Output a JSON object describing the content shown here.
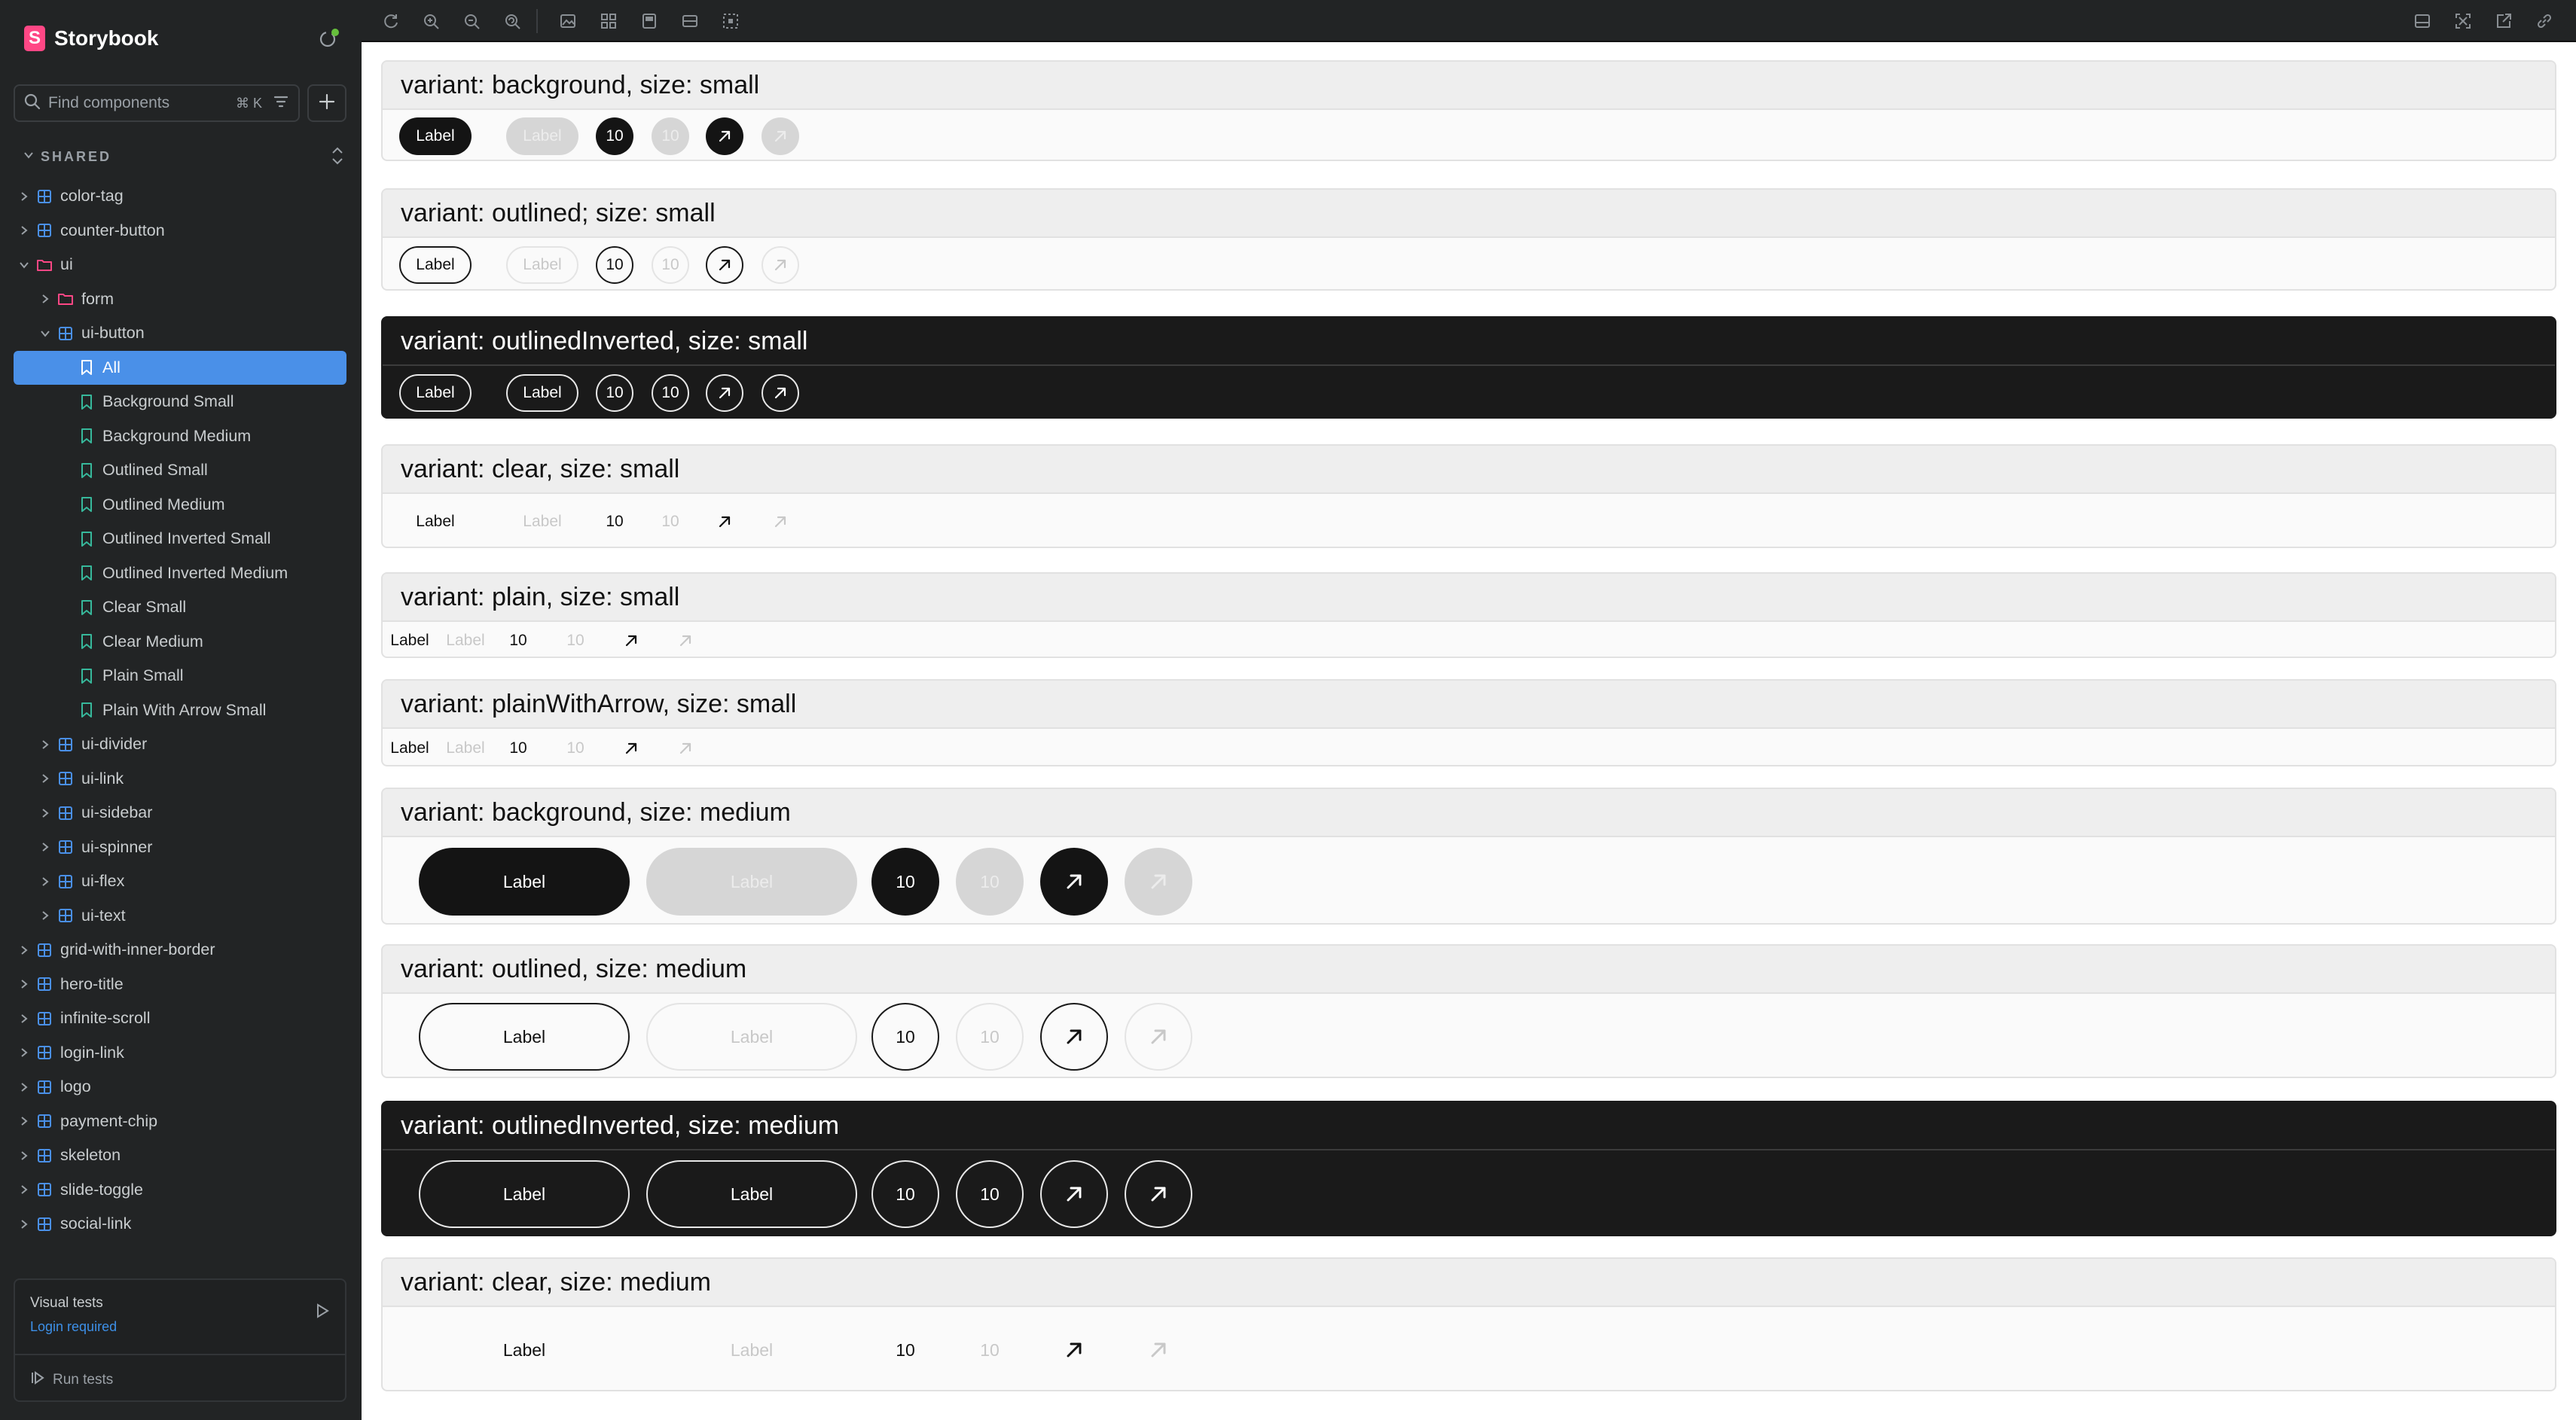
{
  "app": {
    "brand": "Storybook"
  },
  "search": {
    "placeholder": "Find components",
    "shortcut": "⌘ K"
  },
  "section": {
    "label": "SHARED"
  },
  "tree": [
    {
      "label": "color-tag",
      "kind": "component",
      "depth": 0,
      "state": "collapsed"
    },
    {
      "label": "counter-button",
      "kind": "component",
      "depth": 0,
      "state": "collapsed"
    },
    {
      "label": "ui",
      "kind": "folder",
      "depth": 0,
      "state": "expanded"
    },
    {
      "label": "form",
      "kind": "folder",
      "depth": 1,
      "state": "collapsed"
    },
    {
      "label": "ui-button",
      "kind": "component",
      "depth": 1,
      "state": "expanded"
    },
    {
      "label": "All",
      "kind": "story",
      "depth": 2,
      "selected": true
    },
    {
      "label": "Background Small",
      "kind": "story",
      "depth": 2
    },
    {
      "label": "Background Medium",
      "kind": "story",
      "depth": 2
    },
    {
      "label": "Outlined Small",
      "kind": "story",
      "depth": 2
    },
    {
      "label": "Outlined Medium",
      "kind": "story",
      "depth": 2
    },
    {
      "label": "Outlined Inverted Small",
      "kind": "story",
      "depth": 2
    },
    {
      "label": "Outlined Inverted Medium",
      "kind": "story",
      "depth": 2
    },
    {
      "label": "Clear Small",
      "kind": "story",
      "depth": 2
    },
    {
      "label": "Clear Medium",
      "kind": "story",
      "depth": 2
    },
    {
      "label": "Plain Small",
      "kind": "story",
      "depth": 2
    },
    {
      "label": "Plain With Arrow Small",
      "kind": "story",
      "depth": 2
    },
    {
      "label": "ui-divider",
      "kind": "component",
      "depth": 1,
      "state": "collapsed"
    },
    {
      "label": "ui-link",
      "kind": "component",
      "depth": 1,
      "state": "collapsed"
    },
    {
      "label": "ui-sidebar",
      "kind": "component",
      "depth": 1,
      "state": "collapsed"
    },
    {
      "label": "ui-spinner",
      "kind": "component",
      "depth": 1,
      "state": "collapsed"
    },
    {
      "label": "ui-flex",
      "kind": "component",
      "depth": 1,
      "state": "collapsed"
    },
    {
      "label": "ui-text",
      "kind": "component",
      "depth": 1,
      "state": "collapsed"
    },
    {
      "label": "grid-with-inner-border",
      "kind": "component",
      "depth": 0,
      "state": "collapsed"
    },
    {
      "label": "hero-title",
      "kind": "component",
      "depth": 0,
      "state": "collapsed"
    },
    {
      "label": "infinite-scroll",
      "kind": "component",
      "depth": 0,
      "state": "collapsed"
    },
    {
      "label": "login-link",
      "kind": "component",
      "depth": 0,
      "state": "collapsed"
    },
    {
      "label": "logo",
      "kind": "component",
      "depth": 0,
      "state": "collapsed"
    },
    {
      "label": "payment-chip",
      "kind": "component",
      "depth": 0,
      "state": "collapsed"
    },
    {
      "label": "skeleton",
      "kind": "component",
      "depth": 0,
      "state": "collapsed"
    },
    {
      "label": "slide-toggle",
      "kind": "component",
      "depth": 0,
      "state": "collapsed"
    },
    {
      "label": "social-link",
      "kind": "component",
      "depth": 0,
      "state": "collapsed"
    }
  ],
  "visual_tests": {
    "title": "Visual tests",
    "subtitle": "Login required",
    "run_label": "Run tests"
  },
  "toolbar": {
    "left": [
      "reload-icon",
      "zoom-in-icon",
      "zoom-out-icon",
      "zoom-reset-icon",
      "background-icon",
      "grid-icon",
      "viewport-icon",
      "measure-icon",
      "outline-icon"
    ],
    "right": [
      "panel-icon",
      "fullscreen-icon",
      "open-new-tab-icon",
      "copy-link-icon"
    ]
  },
  "variants": [
    {
      "title": "variant: background, size: small",
      "variant": "background",
      "size": "small"
    },
    {
      "title": "variant: outlined; size: small",
      "variant": "outlined",
      "size": "small"
    },
    {
      "title": "variant: outlinedInverted, size: small",
      "variant": "outlinedInverted",
      "size": "small",
      "dark": true
    },
    {
      "title": "variant: clear, size: small",
      "variant": "clear",
      "size": "small"
    },
    {
      "title": "variant: plain, size: small",
      "variant": "plain",
      "size": "small"
    },
    {
      "title": "variant: plainWithArrow, size: small",
      "variant": "plainWithArrow",
      "size": "small"
    },
    {
      "title": "variant: background, size: medium",
      "variant": "background",
      "size": "medium"
    },
    {
      "title": "variant: outlined, size: medium",
      "variant": "outlined",
      "size": "medium"
    },
    {
      "title": "variant: outlinedInverted, size: medium",
      "variant": "outlinedInverted",
      "size": "medium",
      "dark": true
    },
    {
      "title": "variant: clear, size: medium",
      "variant": "clear",
      "size": "medium"
    }
  ],
  "buttons": [
    {
      "text": "Label",
      "disabled": false
    },
    {
      "text": "Label",
      "disabled": true
    },
    {
      "text": "10",
      "disabled": false
    },
    {
      "text": "10",
      "disabled": true
    },
    {
      "icon": "arrow-up-right-icon",
      "disabled": false
    },
    {
      "icon": "arrow-up-right-icon",
      "disabled": true
    }
  ],
  "colors": {
    "accent": "#4a90e8",
    "brand": "#ff4785",
    "sidebar_bg": "#222425",
    "dark_block": "#1a1a1a"
  }
}
